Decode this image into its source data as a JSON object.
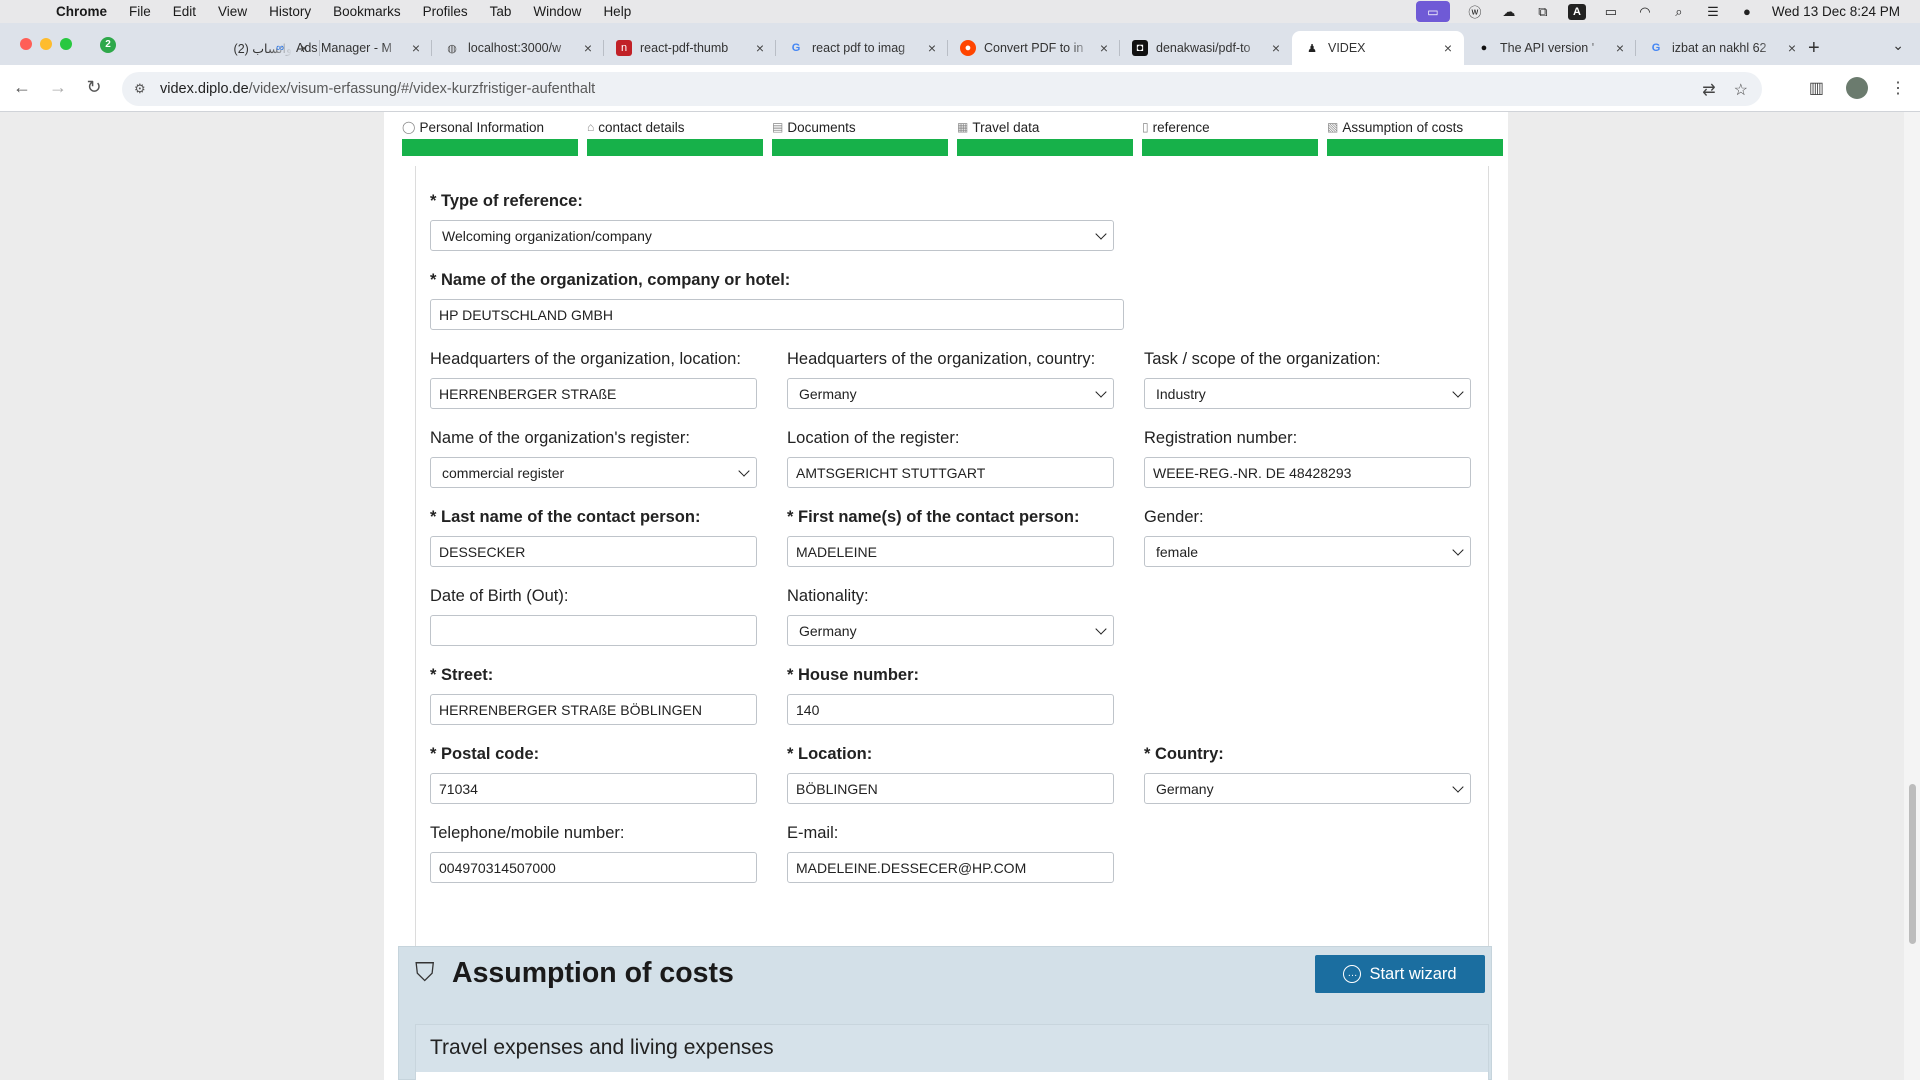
{
  "menubar": {
    "apple": "",
    "items": [
      "Chrome",
      "File",
      "Edit",
      "View",
      "History",
      "Bookmarks",
      "Profiles",
      "Tab",
      "Window",
      "Help"
    ],
    "clock": "Wed 13 Dec  8:24 PM",
    "a_glyph": "A"
  },
  "tabs": {
    "count_badge": "2",
    "items": [
      {
        "title": "(2) واتساب",
        "icon": "whatsapp-icon"
      },
      {
        "title": "Ads Manager - M",
        "icon": "meta-icon"
      },
      {
        "title": "localhost:3000/w",
        "icon": "globe-icon"
      },
      {
        "title": "react-pdf-thumb",
        "icon": "npm-icon"
      },
      {
        "title": "react pdf to imag",
        "icon": "google-icon"
      },
      {
        "title": "Convert PDF to in",
        "icon": "reddit-icon"
      },
      {
        "title": "denakwasi/pdf-to",
        "icon": "github-icon"
      },
      {
        "title": "VIDEX",
        "icon": "eagle-icon"
      },
      {
        "title": "The API version '",
        "icon": "github-icon"
      },
      {
        "title": "izbat an nakhl 62",
        "icon": "google-icon"
      }
    ],
    "new_tab": "+"
  },
  "address": {
    "host": "videx.diplo.de",
    "path": "/videx/visum-erfassung/#/videx-kurzfristiger-aufenthalt"
  },
  "steps": [
    {
      "label": "Personal Information",
      "icon": "person-icon",
      "progress": 1.0
    },
    {
      "label": "contact details",
      "icon": "home-icon",
      "progress": 1.0
    },
    {
      "label": "Documents",
      "icon": "id-card-icon",
      "progress": 1.0
    },
    {
      "label": "Travel data",
      "icon": "map-icon",
      "progress": 1.0
    },
    {
      "label": "reference",
      "icon": "document-icon",
      "progress": 1.0
    },
    {
      "label": "Assumption of costs",
      "icon": "money-icon",
      "progress": 1.0
    }
  ],
  "form": {
    "type_of_reference": {
      "label": "* Type of reference:",
      "value": "Welcoming organization/company"
    },
    "org_name": {
      "label": "* Name of the organization, company or hotel:",
      "value": "HP DEUTSCHLAND GMBH"
    },
    "hq_location": {
      "label": "Headquarters of the organization, location:",
      "value": "HERRENBERGER STRAßE"
    },
    "hq_country": {
      "label": "Headquarters of the organization, country:",
      "value": "Germany"
    },
    "task_scope": {
      "label": "Task / scope of the organization:",
      "value": "Industry"
    },
    "register_name": {
      "label": "Name of the organization's register:",
      "value": "commercial register"
    },
    "register_location": {
      "label": "Location of the register:",
      "value": "AMTSGERICHT STUTTGART"
    },
    "registration_number": {
      "label": "Registration number:",
      "value": "WEEE-REG.-NR. DE 48428293"
    },
    "contact_last_name": {
      "label": "* Last name of the contact person:",
      "value": "DESSECKER"
    },
    "contact_first_name": {
      "label": "* First name(s) of the contact person:",
      "value": "MADELEINE"
    },
    "gender": {
      "label": "Gender:",
      "value": "female"
    },
    "date_of_birth": {
      "label": "Date of Birth (Out):",
      "value": ""
    },
    "nationality": {
      "label": "Nationality:",
      "value": "Germany"
    },
    "street": {
      "label": "* Street:",
      "value": "HERRENBERGER STRAßE BÖBLINGEN"
    },
    "house_number": {
      "label": "* House number:",
      "value": "140"
    },
    "postal_code": {
      "label": "* Postal code:",
      "value": "71034"
    },
    "location": {
      "label": "* Location:",
      "value": "BÖBLINGEN"
    },
    "country": {
      "label": "* Country:",
      "value": "Germany"
    },
    "telephone": {
      "label": "Telephone/mobile number:",
      "value": "004970314507000"
    },
    "email": {
      "label": "E-mail:",
      "value": "MADELEINE.DESSECER@HP.COM"
    }
  },
  "costs_section": {
    "title": "Assumption of costs",
    "wizard_button": "Start wizard",
    "subsection": "Travel expenses and living expenses"
  },
  "colors": {
    "progress_green": "#17b14a",
    "wizard_blue": "#1b6ea0",
    "section_bg": "#d3e0e8"
  }
}
